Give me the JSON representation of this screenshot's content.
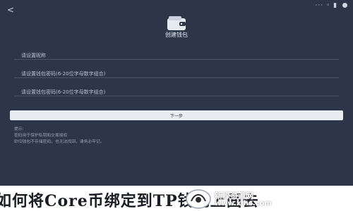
{
  "status_bar": {
    "time": "<",
    "icons": "··· ◦ ▮"
  },
  "header": {
    "title": "创建钱包"
  },
  "form": {
    "name_placeholder": "请设置昵称",
    "password_placeholder": "请设置钱包密码(6-20位字母数字组合)",
    "confirm_placeholder": "请设置钱包密码(6-20位字母数字组合)"
  },
  "next_button": "下一步",
  "tips": [
    "提示:",
    "密码用于保护私钥和交易授权",
    "BYD钱包不存储密码，也无法找回，请务必牢记。"
  ],
  "banner": {
    "title": "如何将Core币绑定到TP钱包上面去"
  },
  "watermark": {
    "name": "新绿资源网",
    "url": "www.xlhs.com"
  },
  "colors": {
    "background": "#2c3648",
    "button": "#e9ecf1"
  }
}
